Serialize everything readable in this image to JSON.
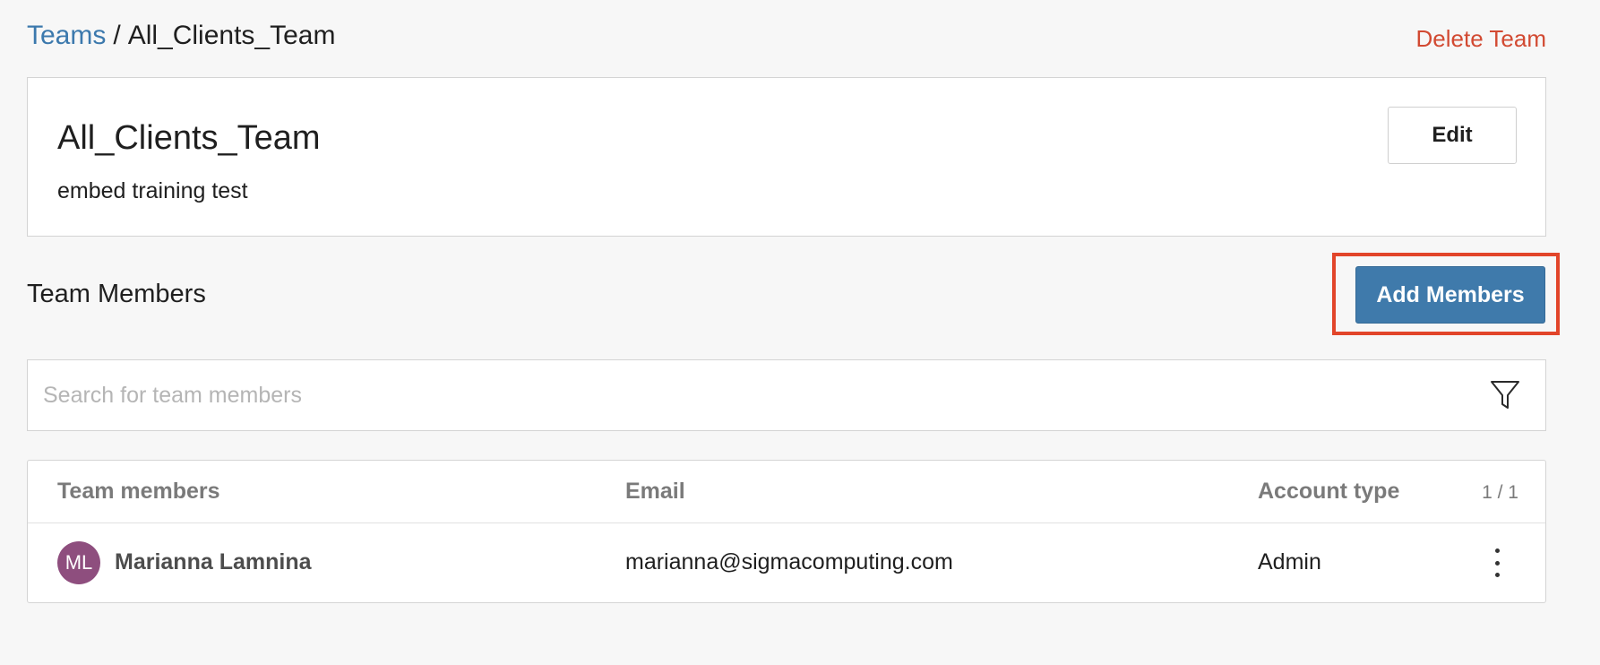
{
  "breadcrumb": {
    "parent": "Teams",
    "separator": "/",
    "current": "All_Clients_Team"
  },
  "header": {
    "delete_label": "Delete Team"
  },
  "team": {
    "name": "All_Clients_Team",
    "description": "embed training test",
    "edit_label": "Edit"
  },
  "members_section": {
    "title": "Team Members",
    "add_label": "Add Members"
  },
  "search": {
    "placeholder": "Search for team members",
    "value": ""
  },
  "table": {
    "columns": [
      "Team members",
      "Email",
      "Account type"
    ],
    "page_count": "1 / 1",
    "rows": [
      {
        "initials": "ML",
        "name": "Marianna Lamnina",
        "email": "marianna@sigmacomputing.com",
        "account_type": "Admin"
      }
    ]
  },
  "colors": {
    "link": "#3c79ad",
    "danger": "#d24a32",
    "primary_button": "#3f7aab",
    "highlight": "#e2452a",
    "avatar": "#8e4e7e"
  },
  "icons": {
    "filter": "filter-icon",
    "row_menu": "more-vertical-icon"
  }
}
